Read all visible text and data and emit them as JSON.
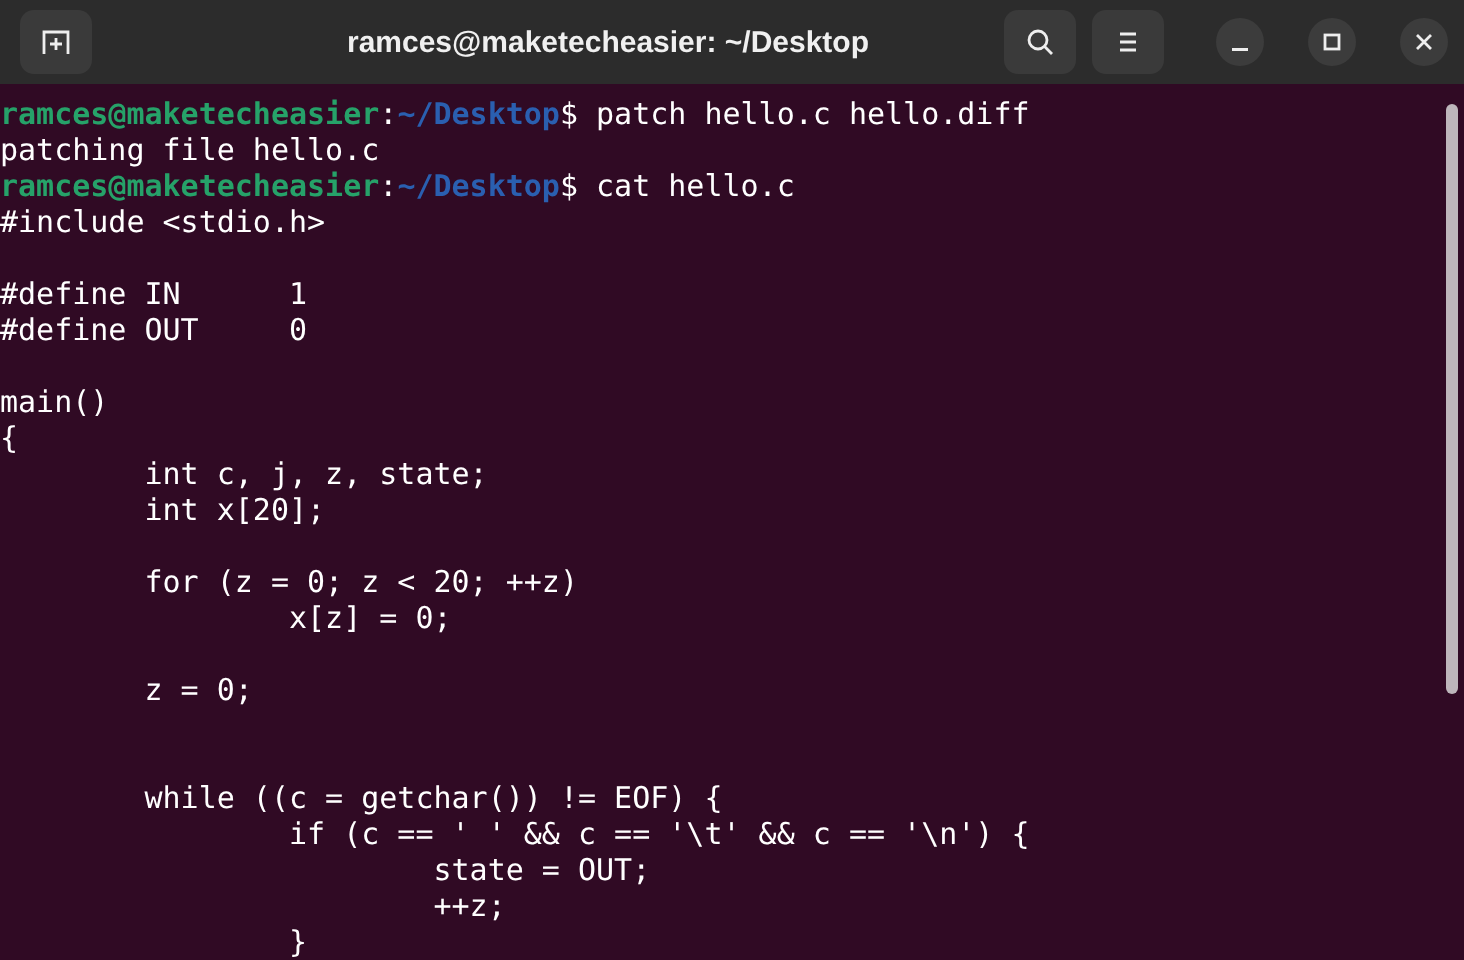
{
  "window": {
    "title": "ramces@maketecheasier: ~/Desktop"
  },
  "terminal": {
    "lines": [
      {
        "kind": "prompt",
        "user": "ramces@maketecheasier",
        "separator": ":",
        "path": "~/Desktop",
        "symbol": "$",
        "command": " patch hello.c hello.diff"
      },
      {
        "kind": "output",
        "text": "patching file hello.c"
      },
      {
        "kind": "prompt",
        "user": "ramces@maketecheasier",
        "separator": ":",
        "path": "~/Desktop",
        "symbol": "$",
        "command": " cat hello.c"
      },
      {
        "kind": "output",
        "text": "#include <stdio.h>"
      },
      {
        "kind": "blank"
      },
      {
        "kind": "output",
        "text": "#define IN      1"
      },
      {
        "kind": "output",
        "text": "#define OUT     0"
      },
      {
        "kind": "blank"
      },
      {
        "kind": "output",
        "text": "main()"
      },
      {
        "kind": "output",
        "text": "{"
      },
      {
        "kind": "output",
        "text": "        int c, j, z, state;"
      },
      {
        "kind": "output",
        "text": "        int x[20];"
      },
      {
        "kind": "blank"
      },
      {
        "kind": "output",
        "text": "        for (z = 0; z < 20; ++z)"
      },
      {
        "kind": "output",
        "text": "                x[z] = 0;"
      },
      {
        "kind": "blank"
      },
      {
        "kind": "output",
        "text": "        z = 0;"
      },
      {
        "kind": "blank"
      },
      {
        "kind": "blank"
      },
      {
        "kind": "output",
        "text": "        while ((c = getchar()) != EOF) {"
      },
      {
        "kind": "output",
        "text": "                if (c == ' ' && c == '\\t' && c == '\\n') {"
      },
      {
        "kind": "output",
        "text": "                        state = OUT;"
      },
      {
        "kind": "output",
        "text": "                        ++z;"
      },
      {
        "kind": "output",
        "text": "                }"
      }
    ]
  }
}
